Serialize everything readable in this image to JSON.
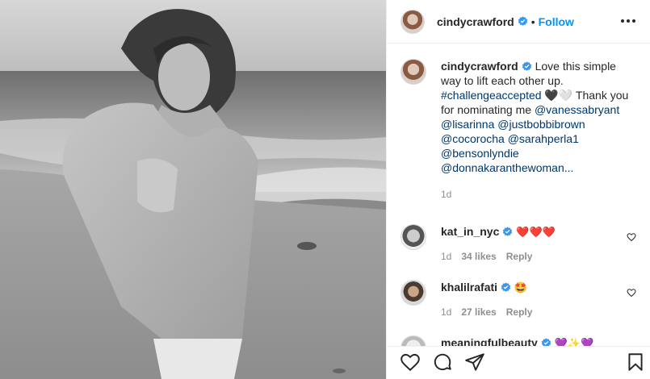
{
  "post": {
    "author": "cindycrawford",
    "follow_label": "Follow",
    "separator": "•",
    "photo_alt": "black and white photo on the beach"
  },
  "caption": {
    "username": "cindycrawford",
    "text_1": " Love this simple way to lift each other up. ",
    "hashtag": "#challengeaccepted",
    "text_2": " 🖤🤍 Thank you for nominating me ",
    "mentions": [
      "@vanessabryant",
      "@lisarinna",
      "@justbobbibrown",
      "@cocorocha",
      "@sarahperla1",
      "@bensonlyndie",
      "@donnakaranthewoman"
    ],
    "ellipsis": "...",
    "time": "1d"
  },
  "comments": [
    {
      "username": "kat_in_nyc",
      "text": "❤️❤️❤️",
      "time": "1d",
      "likes": "34 likes",
      "reply": "Reply"
    },
    {
      "username": "khalilrafati",
      "text": "🤩",
      "time": "1d",
      "likes": "27 likes",
      "reply": "Reply"
    },
    {
      "username": "meaningfulbeauty",
      "text": "💜✨💜",
      "time": "",
      "likes": "",
      "reply": ""
    }
  ],
  "colors": {
    "link": "#00376b",
    "follow": "#0095f6",
    "verified": "#3897f0",
    "muted": "#8e8e8e"
  },
  "icons": [
    "verified-icon",
    "more-icon",
    "heart-icon",
    "comment-icon",
    "share-icon",
    "bookmark-icon"
  ]
}
